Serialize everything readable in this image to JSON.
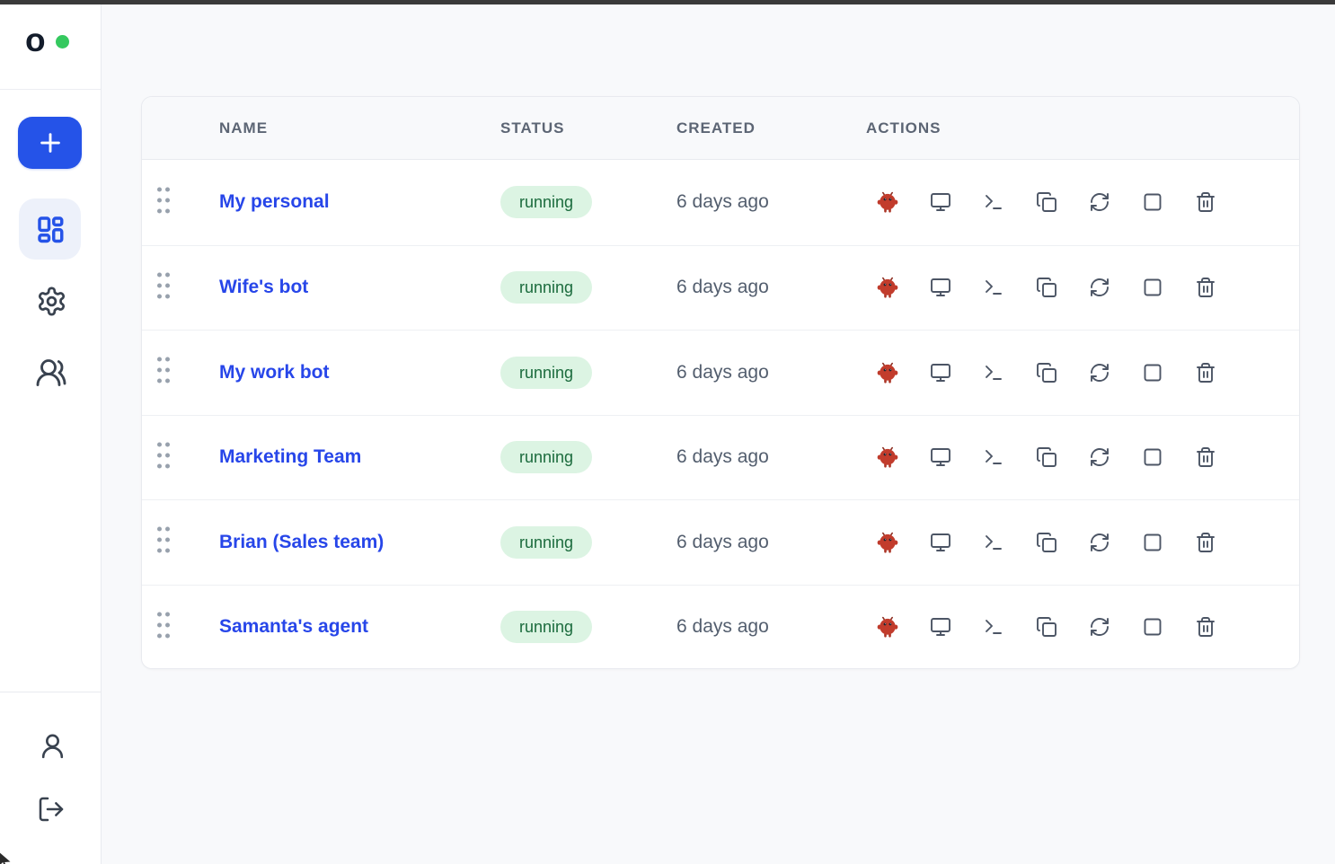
{
  "colors": {
    "accent": "#2553e8",
    "link": "#2746e9",
    "pill-bg": "#dcf4e3",
    "pill-text": "#1b6b3d",
    "online-dot": "#35c95f",
    "bot-red": "#c23c2c",
    "topbar": "#3a3a3a"
  },
  "sidebar": {
    "logo_text": "o",
    "logo_status": "online",
    "nav_icons": [
      "plus",
      "layout-dashboard",
      "gear",
      "users"
    ],
    "bottom_icons": [
      "user",
      "logout"
    ]
  },
  "table": {
    "columns": [
      "NAME",
      "STATUS",
      "CREATED",
      "ACTIONS"
    ],
    "action_icons": [
      "bot",
      "monitor",
      "terminal",
      "copy",
      "refresh",
      "stop",
      "trash"
    ],
    "rows": [
      {
        "name": "My personal",
        "status": "running",
        "created": "6 days ago"
      },
      {
        "name": "Wife's bot",
        "status": "running",
        "created": "6 days ago"
      },
      {
        "name": "My work bot",
        "status": "running",
        "created": "6 days ago"
      },
      {
        "name": "Marketing Team",
        "status": "running",
        "created": "6 days ago"
      },
      {
        "name": "Brian (Sales team)",
        "status": "running",
        "created": "6 days ago"
      },
      {
        "name": "Samanta's agent",
        "status": "running",
        "created": "6 days ago"
      }
    ]
  }
}
